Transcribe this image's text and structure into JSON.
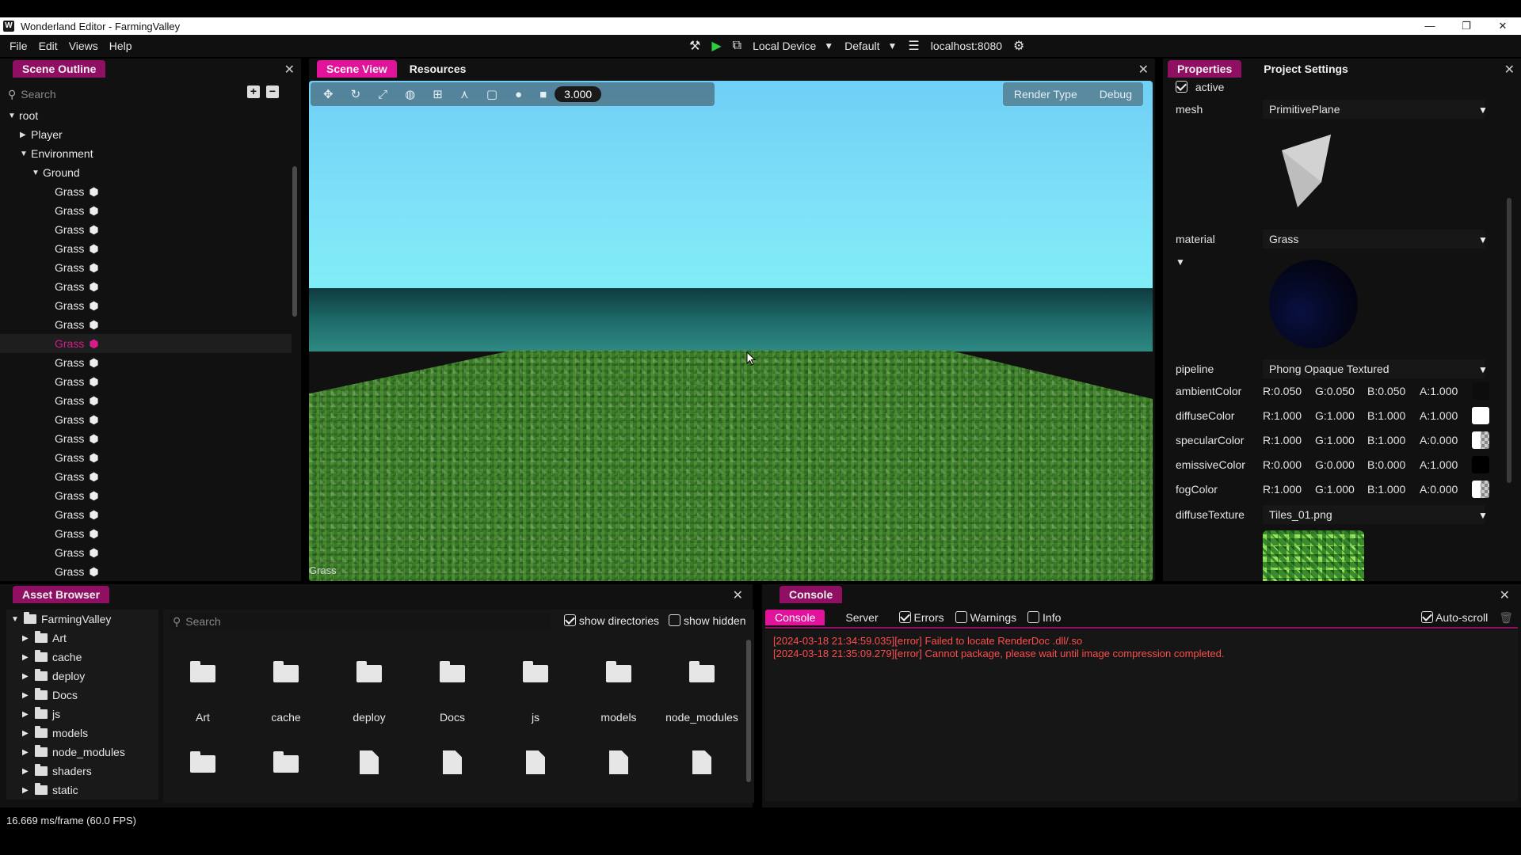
{
  "window": {
    "title": "Wonderland Editor - FarmingValley",
    "app_icon": "W"
  },
  "menu": [
    "File",
    "Edit",
    "Views",
    "Help"
  ],
  "toolbar": {
    "device": "Local Device",
    "profile": "Default",
    "server": "localhost:8080"
  },
  "scene_outline": {
    "title": "Scene Outline",
    "search_placeholder": "Search",
    "tree": [
      {
        "label": "root",
        "depth": 0,
        "expanded": true
      },
      {
        "label": "Player",
        "depth": 1,
        "expanded": false
      },
      {
        "label": "Environment",
        "depth": 1,
        "expanded": true
      },
      {
        "label": "Ground",
        "depth": 2,
        "expanded": true
      },
      {
        "label": "Grass",
        "depth": 3,
        "mesh": true
      },
      {
        "label": "Grass",
        "depth": 3,
        "mesh": true
      },
      {
        "label": "Grass",
        "depth": 3,
        "mesh": true
      },
      {
        "label": "Grass",
        "depth": 3,
        "mesh": true
      },
      {
        "label": "Grass",
        "depth": 3,
        "mesh": true
      },
      {
        "label": "Grass",
        "depth": 3,
        "mesh": true
      },
      {
        "label": "Grass",
        "depth": 3,
        "mesh": true
      },
      {
        "label": "Grass",
        "depth": 3,
        "mesh": true
      },
      {
        "label": "Grass",
        "depth": 3,
        "mesh": true,
        "selected": true
      },
      {
        "label": "Grass",
        "depth": 3,
        "mesh": true
      },
      {
        "label": "Grass",
        "depth": 3,
        "mesh": true
      },
      {
        "label": "Grass",
        "depth": 3,
        "mesh": true
      },
      {
        "label": "Grass",
        "depth": 3,
        "mesh": true
      },
      {
        "label": "Grass",
        "depth": 3,
        "mesh": true
      },
      {
        "label": "Grass",
        "depth": 3,
        "mesh": true
      },
      {
        "label": "Grass",
        "depth": 3,
        "mesh": true
      },
      {
        "label": "Grass",
        "depth": 3,
        "mesh": true
      },
      {
        "label": "Grass",
        "depth": 3,
        "mesh": true
      },
      {
        "label": "Grass",
        "depth": 3,
        "mesh": true
      },
      {
        "label": "Grass",
        "depth": 3,
        "mesh": true
      },
      {
        "label": "Grass",
        "depth": 3,
        "mesh": true
      }
    ]
  },
  "scene_view": {
    "tabs": [
      "Scene View",
      "Resources"
    ],
    "zoom": "3.000",
    "render_type": "Render Type",
    "debug": "Debug",
    "selection_label": "Grass"
  },
  "properties": {
    "tabs": [
      "Properties",
      "Project Settings"
    ],
    "active_label": "active",
    "mesh_label": "mesh",
    "mesh_value": "PrimitivePlane",
    "material_label": "material",
    "material_value": "Grass",
    "pipeline_label": "pipeline",
    "pipeline_value": "Phong Opaque Textured",
    "colors": [
      {
        "name": "ambientColor",
        "r": "R:0.050",
        "g": "G:0.050",
        "b": "B:0.050",
        "a": "A:1.000",
        "swatch": "#0d0d0d"
      },
      {
        "name": "diffuseColor",
        "r": "R:1.000",
        "g": "G:1.000",
        "b": "B:1.000",
        "a": "A:1.000",
        "swatch": "#ffffff"
      },
      {
        "name": "specularColor",
        "r": "R:1.000",
        "g": "G:1.000",
        "b": "B:1.000",
        "a": "A:0.000",
        "swatch": "checker"
      },
      {
        "name": "emissiveColor",
        "r": "R:0.000",
        "g": "G:0.000",
        "b": "B:0.000",
        "a": "A:1.000",
        "swatch": "#000000"
      },
      {
        "name": "fogColor",
        "r": "R:1.000",
        "g": "G:1.000",
        "b": "B:1.000",
        "a": "A:0.000",
        "swatch": "checker"
      }
    ],
    "texture_label": "diffuseTexture",
    "texture_value": "Tiles_01.png"
  },
  "asset_browser": {
    "title": "Asset Browser",
    "search_placeholder": "Search",
    "show_directories": "show directories",
    "show_hidden": "show hidden",
    "tree_root": "FarmingValley",
    "tree": [
      "Art",
      "cache",
      "deploy",
      "Docs",
      "js",
      "models",
      "node_modules",
      "shaders",
      "static"
    ],
    "grid_folders": [
      "Art",
      "cache",
      "deploy",
      "Docs",
      "js",
      "models",
      "node_modules"
    ]
  },
  "console": {
    "title": "Console",
    "tabs": [
      "Console",
      "Server"
    ],
    "filters": [
      "Errors",
      "Warnings",
      "Info"
    ],
    "autoscroll": "Auto-scroll",
    "logs": [
      "[2024-03-18 21:34:59.035][error] Failed to locate RenderDoc .dll/.so",
      "[2024-03-18 21:35:09.279][error] Cannot package, please wait until image compression completed."
    ]
  },
  "status": "16.669 ms/frame (60.0 FPS)",
  "colors": {
    "accent": "#e0139a",
    "accent_dark": "#8f0f63",
    "error": "#ff4d4d"
  }
}
